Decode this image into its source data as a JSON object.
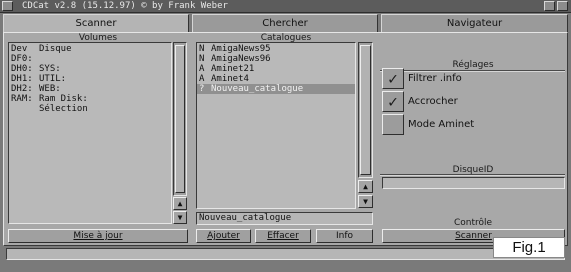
{
  "titlebar": {
    "title": "CDCat v2.8 (15.12.97) © by Frank Weber"
  },
  "tabs": [
    {
      "label": "Scanner",
      "active": true
    },
    {
      "label": "Chercher",
      "active": false
    },
    {
      "label": "Navigateur",
      "active": false
    }
  ],
  "volumes": {
    "group_label": "Volumes",
    "rows": [
      {
        "dev": "Dev",
        "name": "Disque"
      },
      {
        "dev": "DF0:",
        "name": ""
      },
      {
        "dev": "DH0:",
        "name": "SYS:"
      },
      {
        "dev": "DH1:",
        "name": "UTIL:"
      },
      {
        "dev": "DH2:",
        "name": "WEB:"
      },
      {
        "dev": "RAM:",
        "name": "Ram Disk:"
      },
      {
        "dev": "",
        "name": "Sélection"
      }
    ],
    "update_button": "Mise à jour"
  },
  "catalogues": {
    "group_label": "Catalogues",
    "rows": [
      {
        "flag": "N",
        "name": "AmigaNews95",
        "selected": false
      },
      {
        "flag": "N",
        "name": "AmigaNews96",
        "selected": false
      },
      {
        "flag": "A",
        "name": "Aminet21",
        "selected": false
      },
      {
        "flag": "A",
        "name": "Aminet4",
        "selected": false
      },
      {
        "flag": "?",
        "name": "Nouveau_catalogue",
        "selected": true
      }
    ],
    "name_field": "Nouveau_catalogue",
    "add_button": "Ajouter",
    "delete_button": "Effacer",
    "info_button": "Info"
  },
  "settings": {
    "group_label": "Réglages",
    "checkboxes": [
      {
        "label": "Filtrer .info",
        "checked": true
      },
      {
        "label": "Accrocher",
        "checked": true
      },
      {
        "label": "Mode Aminet",
        "checked": false
      }
    ]
  },
  "disk_id": {
    "label": "DisqueID",
    "value": ""
  },
  "control": {
    "label": "Contrôle",
    "scan_button": "Scanner"
  },
  "status": {
    "text": ""
  },
  "figure_label": "Fig.1",
  "icons": {
    "scroll_up": "▲",
    "scroll_down": "▼",
    "check": "✓"
  }
}
